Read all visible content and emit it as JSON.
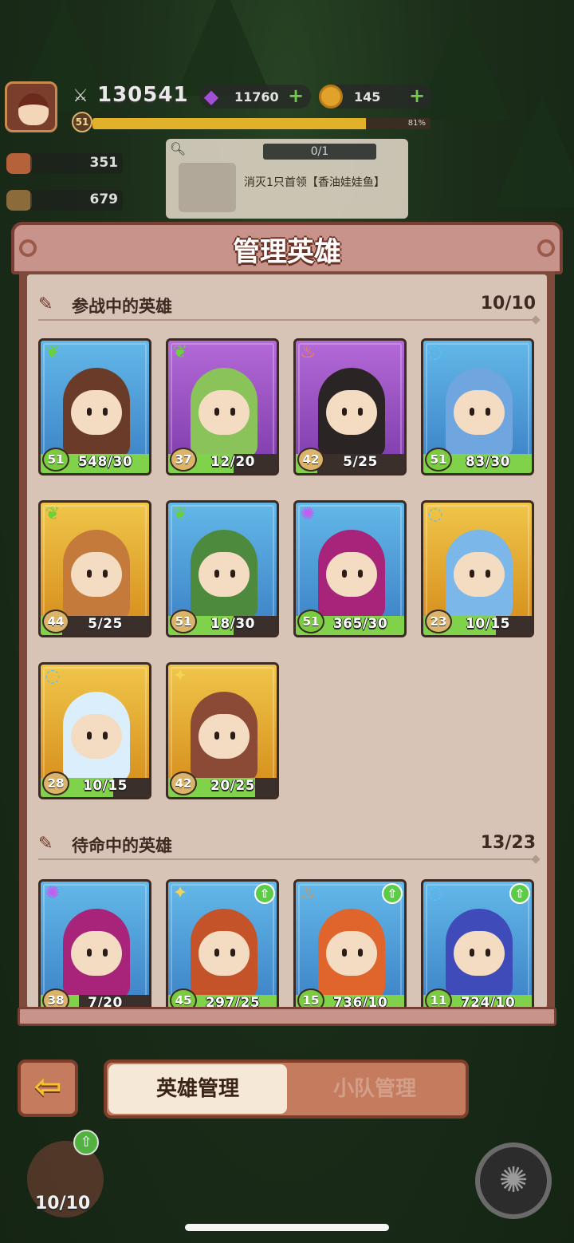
{
  "hud": {
    "power_icon": "sword-icon",
    "power": "130541",
    "gems": "11760",
    "coins": "145",
    "player_level": "51",
    "xp_percent": "81%",
    "xp_fraction": 0.81
  },
  "resources": [
    {
      "name": "meat-icon",
      "value": "351"
    },
    {
      "name": "wood-icon",
      "value": "679"
    }
  ],
  "quest": {
    "progress": "0/1",
    "task": "消灭1只首领【香油娃娃鱼】"
  },
  "panel": {
    "title": "管理英雄",
    "active_section": {
      "label": "参战中的英雄",
      "count": "10/10"
    },
    "reserve_section": {
      "label": "待命中的英雄",
      "count": "13/23"
    }
  },
  "active_heroes": [
    {
      "element": "leaf",
      "level": "51",
      "frags": "548/30",
      "fill": 1.0,
      "quality": "blue",
      "lv": "green",
      "color": "#6b3b2a"
    },
    {
      "element": "leaf",
      "level": "37",
      "frags": "12/20",
      "fill": 0.6,
      "quality": "purple",
      "lv": "tan",
      "color": "#8ac35a"
    },
    {
      "element": "fire",
      "level": "42",
      "frags": "5/25",
      "fill": 0.2,
      "quality": "purple",
      "lv": "tan",
      "color": "#2b2424"
    },
    {
      "element": "water",
      "level": "51",
      "frags": "83/30",
      "fill": 1.0,
      "quality": "blue",
      "lv": "green",
      "color": "#6fa6e0"
    },
    {
      "element": "leaf",
      "level": "44",
      "frags": "5/25",
      "fill": 0.2,
      "quality": "gold",
      "lv": "tan",
      "color": "#c47a3a"
    },
    {
      "element": "leaf",
      "level": "51",
      "frags": "18/30",
      "fill": 0.6,
      "quality": "blue",
      "lv": "tan",
      "color": "#4d8a3e"
    },
    {
      "element": "void",
      "level": "51",
      "frags": "365/30",
      "fill": 1.0,
      "quality": "blue",
      "lv": "green",
      "color": "#a8247a"
    },
    {
      "element": "water",
      "level": "23",
      "frags": "10/15",
      "fill": 0.67,
      "quality": "gold",
      "lv": "tan",
      "color": "#7bb7e8"
    },
    {
      "element": "water",
      "level": "28",
      "frags": "10/15",
      "fill": 0.67,
      "quality": "gold",
      "lv": "tan",
      "color": "#dbeefc"
    },
    {
      "element": "light",
      "level": "42",
      "frags": "20/25",
      "fill": 0.8,
      "quality": "gold",
      "lv": "tan",
      "color": "#8a4a36"
    }
  ],
  "reserve_heroes": [
    {
      "element": "void",
      "level": "38",
      "frags": "7/20",
      "fill": 0.35,
      "quality": "blue",
      "lv": "tan",
      "color": "#a8247a",
      "upgrade": false
    },
    {
      "element": "light",
      "level": "45",
      "frags": "297/25",
      "fill": 1.0,
      "quality": "blue",
      "lv": "green",
      "color": "#c4532a",
      "upgrade": true
    },
    {
      "element": "fire",
      "level": "15",
      "frags": "736/10",
      "fill": 1.0,
      "quality": "blue",
      "lv": "green",
      "color": "#e0652c",
      "upgrade": true
    },
    {
      "element": "water",
      "level": "11",
      "frags": "724/10",
      "fill": 1.0,
      "quality": "blue",
      "lv": "green",
      "color": "#3f4bb8",
      "upgrade": true
    }
  ],
  "nav": {
    "back_icon": "arrow-left-icon",
    "tab_heroes": "英雄管理",
    "tab_squad": "小队管理"
  },
  "squad_count": "10/10",
  "colors": {
    "panel_frame": "#7e4a3c",
    "panel_bg": "#d7c4b7",
    "accent_green": "#7fd24a"
  }
}
